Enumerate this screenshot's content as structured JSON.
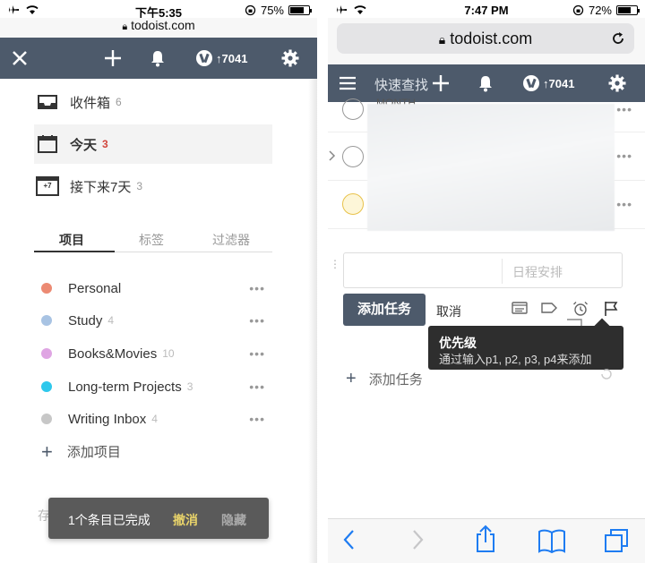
{
  "left": {
    "status": {
      "time": "下午5:35",
      "battery": "75%",
      "battery_level": 0.75
    },
    "url": "todoist.com",
    "karma": "↑7041",
    "nav": [
      {
        "label": "收件箱",
        "count": "6"
      },
      {
        "label": "今天",
        "count": "3"
      },
      {
        "label": "接下来7天",
        "count": "3",
        "icon_text": "+7"
      }
    ],
    "tabs": [
      "项目",
      "标签",
      "过滤器"
    ],
    "projects": [
      {
        "name": "Personal",
        "count": "",
        "color": "#ec8a73"
      },
      {
        "name": "Study",
        "count": "4",
        "color": "#a8c3e3"
      },
      {
        "name": "Books&Movies",
        "count": "10",
        "color": "#dfa5e3"
      },
      {
        "name": "Long-term Projects",
        "count": "3",
        "color": "#2ec8ec"
      },
      {
        "name": "Writing Inbox",
        "count": "4",
        "color": "#c7c7c7"
      }
    ],
    "more": "•••",
    "add_project": "添加项目",
    "ghost_text": "存",
    "toast": {
      "message": "1个条目已完成",
      "undo": "撤消",
      "hide": "隐藏"
    }
  },
  "right": {
    "status": {
      "time": "7:47 PM",
      "battery": "72%",
      "battery_level": 0.72
    },
    "url": "todoist.com",
    "quick_find": "快速查找",
    "karma": "↑7041",
    "partial_task": "MONTH",
    "more": "•••",
    "schedule_placeholder": "日程安排",
    "add_button": "添加任务",
    "cancel": "取消",
    "tooltip": {
      "title": "优先级",
      "body": "通过输入p1, p2, p3, p4来添加"
    },
    "add_task": "添加任务"
  },
  "colors": {
    "toolbar": "#4d5a6b",
    "accent_red": "#d1453b",
    "ios_blue": "#1e7cf2"
  }
}
